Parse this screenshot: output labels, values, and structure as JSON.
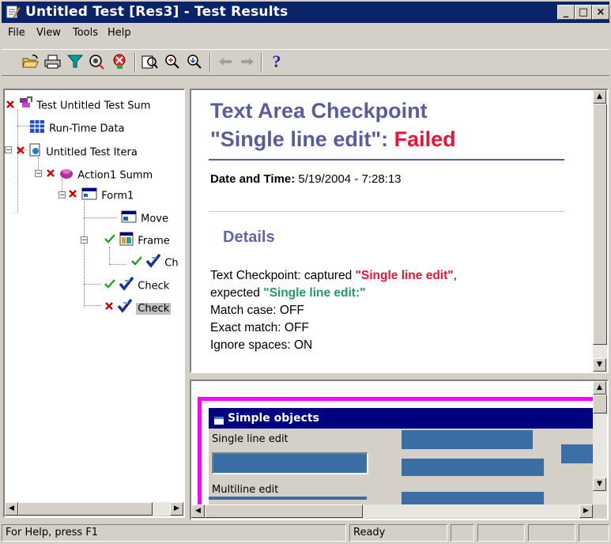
{
  "window": {
    "title": "Untitled Test [Res3] - Test Results",
    "min_glyph": "_",
    "max_glyph": "□",
    "close_glyph": "×"
  },
  "menu": [
    "File",
    "View",
    "Tools",
    "Help"
  ],
  "toolbar": {
    "icons": [
      "open-icon",
      "print-icon",
      "filter-icon",
      "find-icon",
      "remove-icon",
      "zoom-icon",
      "zoom-in-icon",
      "zoom-out-icon",
      "back-icon",
      "forward-icon",
      "help-icon"
    ],
    "help_glyph": "?"
  },
  "tree": {
    "items": [
      {
        "label": "Test Untitled Test Sum",
        "status": "failed"
      },
      {
        "label": "Run-Time Data",
        "status": "none"
      },
      {
        "label": "Untitled Test Itera",
        "status": "failed"
      },
      {
        "label": "Action1 Summ",
        "status": "failed"
      },
      {
        "label": "Form1",
        "status": "failed"
      },
      {
        "label": "Move",
        "status": "none"
      },
      {
        "label": "Frame",
        "status": "passed"
      },
      {
        "label": "Ch",
        "status": "passed"
      },
      {
        "label": "Check",
        "status": "passed"
      },
      {
        "label": "Check",
        "status": "failed",
        "selected": true
      }
    ]
  },
  "report": {
    "title_line1": "Text Area Checkpoint",
    "title_line2_prefix": "\"Single line edit\": ",
    "title_status": "Failed",
    "date_label": "Date and Time:",
    "date_value": " 5/19/2004 - 7:28:13",
    "details_heading": "Details",
    "line1_prefix": "Text Checkpoint: captured ",
    "line1_captured": "\"Single line edit\"",
    "line1_suffix": ",",
    "line2_prefix": "expected ",
    "line2_expected": "\"Single line edit:\"",
    "line3": "Match case: OFF",
    "line4": "Exact match: OFF",
    "line5": "Ignore spaces: ON"
  },
  "snapshot": {
    "window_title": "Simple objects",
    "single_line_label": "Single line edit",
    "multiline_label": "Multiline edit"
  },
  "status": {
    "help": "For Help, press F1",
    "state": "Ready"
  },
  "colors": {
    "title_bar": "#0a246a",
    "report_heading": "#5a5ca0",
    "failed": "#ee1133",
    "expected": "#229966",
    "highlight": "#ff00ff"
  }
}
